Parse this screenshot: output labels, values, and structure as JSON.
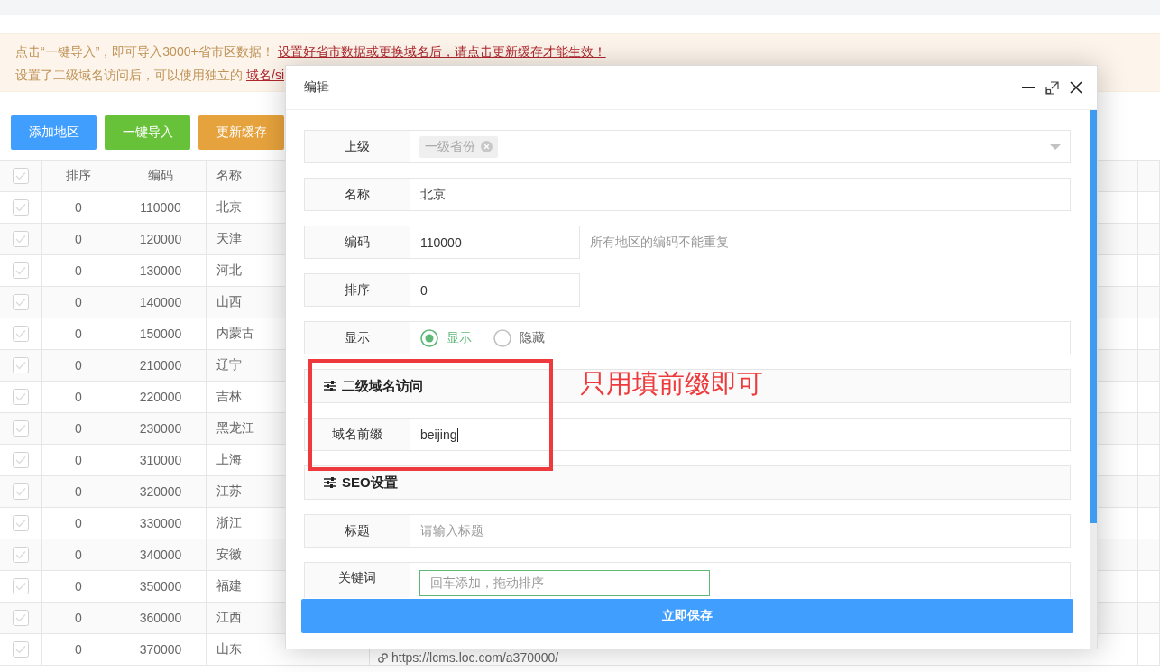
{
  "notice": {
    "lines": [
      {
        "text": "点击“一键导入”，即可导入3000+省市区数据！",
        "link": "设置好省市数据或更换域名后，请点击更新缓存才能生效！"
      },
      {
        "text": "设置了二级域名访问后，可以使用独立的",
        "link": "域名/si"
      }
    ]
  },
  "toolbar": {
    "buttons": [
      {
        "label": "添加地区",
        "kind": "primary"
      },
      {
        "label": "一键导入",
        "kind": "success"
      },
      {
        "label": "更新缓存",
        "kind": "warning"
      }
    ]
  },
  "table": {
    "select_all": {
      "checked": false
    },
    "columns": [
      "排序",
      "编码",
      "名称"
    ],
    "rows": [
      {
        "checked": false,
        "sort": "0",
        "code": "110000",
        "name": "北京"
      },
      {
        "checked": false,
        "sort": "0",
        "code": "120000",
        "name": "天津"
      },
      {
        "checked": false,
        "sort": "0",
        "code": "130000",
        "name": "河北"
      },
      {
        "checked": false,
        "sort": "0",
        "code": "140000",
        "name": "山西"
      },
      {
        "checked": false,
        "sort": "0",
        "code": "150000",
        "name": "内蒙古"
      },
      {
        "checked": false,
        "sort": "0",
        "code": "210000",
        "name": "辽宁"
      },
      {
        "checked": false,
        "sort": "0",
        "code": "220000",
        "name": "吉林"
      },
      {
        "checked": false,
        "sort": "0",
        "code": "230000",
        "name": "黑龙江"
      },
      {
        "checked": false,
        "sort": "0",
        "code": "310000",
        "name": "上海"
      },
      {
        "checked": false,
        "sort": "0",
        "code": "320000",
        "name": "江苏"
      },
      {
        "checked": false,
        "sort": "0",
        "code": "330000",
        "name": "浙江"
      },
      {
        "checked": false,
        "sort": "0",
        "code": "340000",
        "name": "安徽"
      },
      {
        "checked": false,
        "sort": "0",
        "code": "350000",
        "name": "福建"
      },
      {
        "checked": false,
        "sort": "0",
        "code": "360000",
        "name": "江西"
      },
      {
        "checked": false,
        "sort": "0",
        "code": "370000",
        "name": "山东",
        "column_5": "https://lcms.loc.com/a370000/"
      }
    ]
  },
  "dialog": {
    "title": "编辑",
    "fields": [
      {
        "kind": "select",
        "label": "上级",
        "tag": "一级省份"
      },
      {
        "kind": "text",
        "label": "名称",
        "value": "北京"
      },
      {
        "kind": "inline",
        "label": "编码",
        "value": "110000",
        "hint": "所有地区的编码不能重复"
      },
      {
        "kind": "inline",
        "label": "排序",
        "value": "0"
      },
      {
        "kind": "radio",
        "label": "显示",
        "options": [
          {
            "label": "显示",
            "selected": true
          },
          {
            "label": "隐藏",
            "selected": false
          }
        ]
      },
      {
        "kind": "section",
        "title": "二级域名访问"
      },
      {
        "kind": "text",
        "label": "域名前缀",
        "value": "beijing",
        "focused": true
      },
      {
        "kind": "section",
        "title": "SEO设置"
      },
      {
        "kind": "text",
        "label": "标题",
        "placeholder": "请输入标题"
      },
      {
        "kind": "tags",
        "label": "关键词",
        "placeholder": "回车添加，拖动排序"
      }
    ],
    "annotation": "只用填前缀即可",
    "save_button": "立即保存"
  }
}
